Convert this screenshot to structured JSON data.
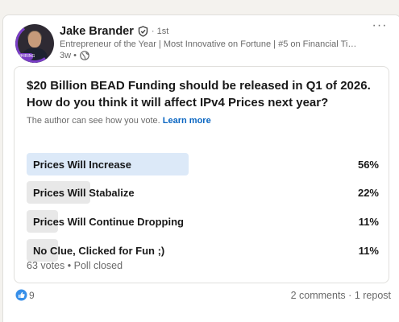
{
  "author": {
    "name": "Jake Brander",
    "degree": "· 1st",
    "headline": "Entrepreneur of the Year | Most Innovative on Fortune | #5 on Financial Ti…",
    "time": "3w •",
    "avatar_ring_label": "#HIRING"
  },
  "post": {
    "more_label": "···"
  },
  "poll": {
    "question": "$20 Billion BEAD Funding should be released in Q1 of 2026. How do you think it will affect IPv4 Prices next year?",
    "author_note": "The author can see how you vote.",
    "learn_more": "Learn more",
    "options": [
      {
        "label": "Prices Will Increase",
        "percent_text": "56%",
        "share": 0.46
      },
      {
        "label": "Prices Will Stabalize",
        "percent_text": "22%",
        "share": 0.18
      },
      {
        "label": "Prices Will Continue Dropping",
        "percent_text": "11%",
        "share": 0.09
      },
      {
        "label": "No Clue, Clicked for Fun ;)",
        "percent_text": "11%",
        "share": 0.09
      }
    ],
    "votes": "63 votes",
    "separator": "•",
    "status": "Poll closed"
  },
  "social": {
    "reaction_count": "9",
    "comments": "2 comments",
    "separator": "·",
    "reposts": "1 repost"
  },
  "colors": {
    "brand_blue": "#0a66c2",
    "leading_option_fill": "#dce9f8",
    "option_fill": "#e8e8e8",
    "avatar_ring": "#7b3fc7"
  }
}
